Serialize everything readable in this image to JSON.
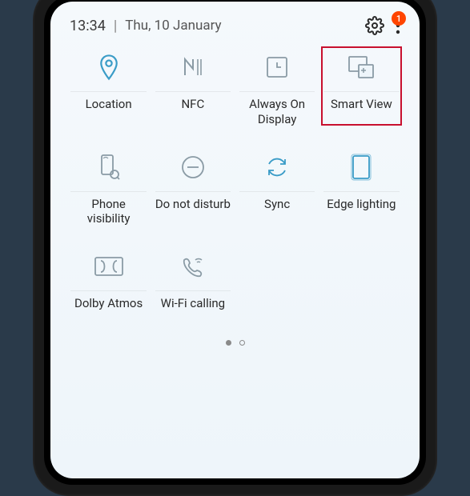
{
  "status": {
    "time": "13:34",
    "date": "Thu, 10 January",
    "notification_count": "1"
  },
  "icons": {
    "settings": "settings-gear",
    "menu": "three-dots"
  },
  "tiles": [
    {
      "label": "Location",
      "icon": "location-pin",
      "highlighted": false
    },
    {
      "label": "NFC",
      "icon": "nfc",
      "highlighted": false
    },
    {
      "label": "Always On Display",
      "icon": "clock-square",
      "highlighted": false
    },
    {
      "label": "Smart View",
      "icon": "smart-view",
      "highlighted": true
    },
    {
      "label": "Phone visibility",
      "icon": "phone-visibility",
      "highlighted": false
    },
    {
      "label": "Do not disturb",
      "icon": "dnd",
      "highlighted": false
    },
    {
      "label": "Sync",
      "icon": "sync",
      "highlighted": false
    },
    {
      "label": "Edge lighting",
      "icon": "edge-lighting",
      "highlighted": false
    },
    {
      "label": "Dolby Atmos",
      "icon": "dolby",
      "highlighted": false
    },
    {
      "label": "Wi-Fi calling",
      "icon": "wifi-calling",
      "highlighted": false
    }
  ],
  "pager": {
    "count": 2,
    "active": 0
  },
  "colors": {
    "highlight": "#c8102e",
    "active_tile": "#3a9cc7",
    "inactive_tile": "#8a9ba5",
    "badge": "#ff4500"
  }
}
